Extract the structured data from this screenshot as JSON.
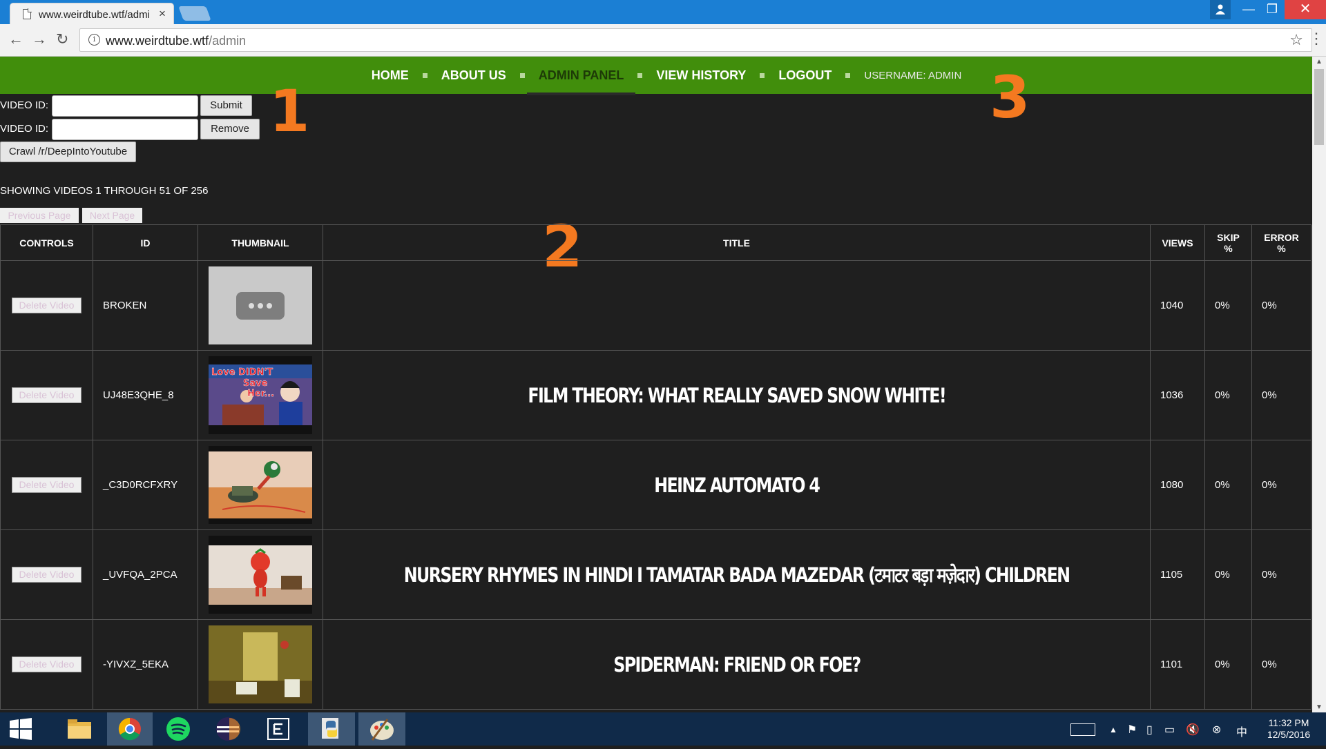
{
  "browser": {
    "tab_title": "www.weirdtube.wtf/admi",
    "tab_close": "×",
    "url_host": "www.weirdtube.wtf",
    "url_path": "/admin"
  },
  "nav": {
    "home": "HOME",
    "about": "ABOUT US",
    "admin": "ADMIN PANEL",
    "history": "VIEW HISTORY",
    "logout": "LOGOUT",
    "username": "USERNAME: ADMIN"
  },
  "annotations": [
    "1",
    "2",
    "3"
  ],
  "form": {
    "add_label": "VIDEO ID:",
    "add_value": "",
    "submit_label": "Submit",
    "remove_label_text": "VIDEO ID:",
    "remove_value": "",
    "remove_button": "Remove",
    "crawl_button": "Crawl /r/DeepIntoYoutube"
  },
  "listing": {
    "showing_text": "SHOWING VIDEOS 1 THROUGH 51 OF 256",
    "prev_label": "Previous Page",
    "next_label": "Next Page"
  },
  "table": {
    "headers": {
      "controls": "CONTROLS",
      "id": "ID",
      "thumbnail": "THUMBNAIL",
      "title": "TITLE",
      "views": "VIEWS",
      "skip_line1": "SKIP",
      "skip_line2": "%",
      "error_line1": "ERROR",
      "error_line2": "%"
    },
    "delete_label": "Delete Video",
    "rows": [
      {
        "id": "BROKEN",
        "title": "",
        "views": "1040",
        "skip": "0%",
        "error": "0%"
      },
      {
        "id": "UJ48E3QHE_8",
        "title": "FILM THEORY: WHAT REALLY SAVED SNOW WHITE!",
        "views": "1036",
        "skip": "0%",
        "error": "0%"
      },
      {
        "id": "_C3D0RCFXRY",
        "title": "HEINZ AUTOMATO 4",
        "views": "1080",
        "skip": "0%",
        "error": "0%"
      },
      {
        "id": "_UVFQA_2PCA",
        "title": "NURSERY RHYMES IN HINDI I TAMATAR BADA MAZEDAR (टमाटर बड़ा मज़ेदार) CHILDREN",
        "views": "1105",
        "skip": "0%",
        "error": "0%"
      },
      {
        "id": "-YIVXZ_5EKA",
        "title": "SPIDERMAN: FRIEND OR FOE?",
        "views": "1101",
        "skip": "0%",
        "error": "0%"
      }
    ]
  },
  "thumb_text": {
    "snow_white_line1": "Love DIDN'T",
    "snow_white_line2": "Save",
    "snow_white_line3": "Her..."
  },
  "taskbar": {
    "time": "11:32 PM",
    "date": "12/5/2016"
  },
  "colors": {
    "nav_green": "#418e0c",
    "annotation_orange": "#f47920",
    "page_bg": "#1f1f1f",
    "taskbar_bg": "#102a49",
    "chrome_blue": "#1b7fd4"
  }
}
